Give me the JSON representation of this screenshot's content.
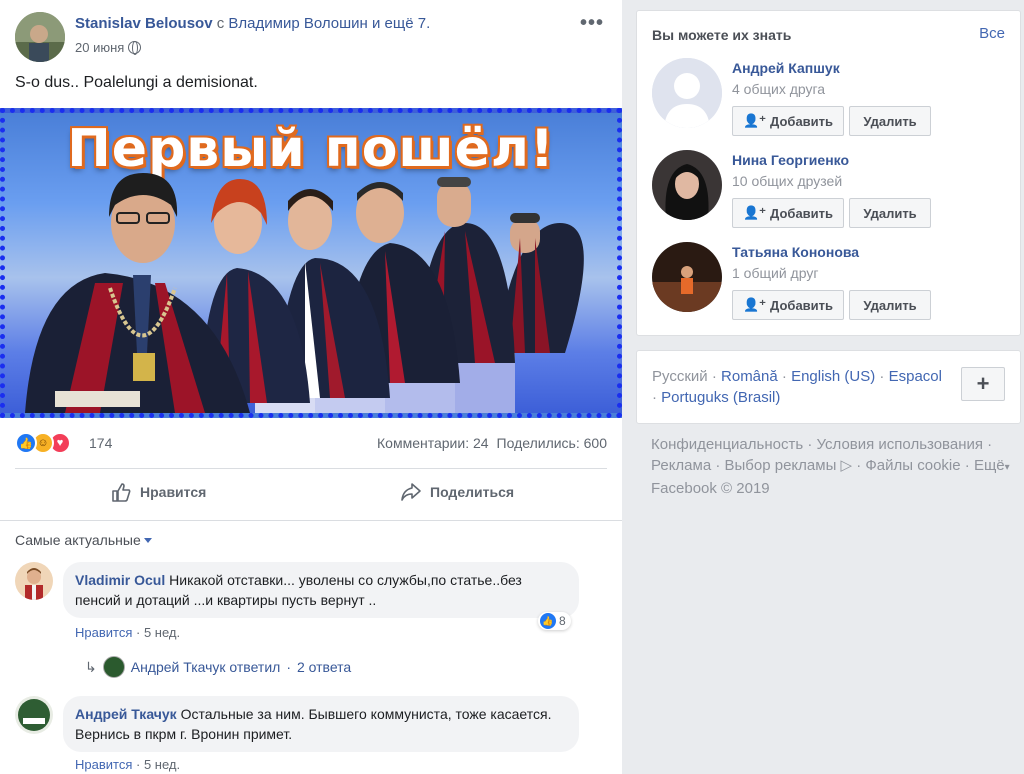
{
  "post": {
    "author": "Stanislav Belousov",
    "with_word": "с",
    "tagged": "Владимир Волошин",
    "and_others": "и ещё 7.",
    "date": "20 июня",
    "text": "S-o dus.. Poalelungi a demisionat.",
    "image_caption": "Первый пошёл!",
    "reaction_count": "174",
    "comments_stat": "Комментарии: 24",
    "shares_stat": "Поделились: 600",
    "like_label": "Нравится",
    "share_label": "Поделиться",
    "sort_label": "Самые актуальные"
  },
  "comments": [
    {
      "author": "Vladimir Ocul",
      "text": "Никакой отставки... уволены со службы,по статье..без пенсий и дотаций ...и квартиры пусть вернут ..",
      "like_action": "Нравится",
      "age": "5 нед.",
      "likes": "8",
      "reply_summary_author": "Андрей Ткачук ответил",
      "reply_count": "2 ответа"
    },
    {
      "author": "Андрей Ткачук",
      "text": "Остальные за ним. Бывшего коммуниста, тоже касается. Вернись в пкрм г. Вронин примет.",
      "like_action": "Нравится",
      "age": "5 нед."
    }
  ],
  "pymk": {
    "title": "Вы можете их знать",
    "see_all": "Все",
    "add_label": "Добавить",
    "remove_label": "Удалить",
    "people": [
      {
        "name": "Андрей Капшук",
        "mutual": "4 общих друга"
      },
      {
        "name": "Нина Георгиенко",
        "mutual": "10 общих друзей"
      },
      {
        "name": "Татьяна Кононова",
        "mutual": "1 общий друг"
      }
    ]
  },
  "languages": {
    "current": "Русский",
    "items": [
      "Română",
      "English (US)",
      "Espacol",
      "Portuguks (Brasil)"
    ],
    "plus": "+"
  },
  "footer": {
    "privacy": "Конфиденциальность",
    "terms": "Условия использования",
    "ads": "Реклама",
    "ad_choices": "Выбор рекламы",
    "cookies": "Файлы cookie",
    "more": "Ещё",
    "copyright": "Facebook © 2019"
  },
  "colors": {
    "link": "#385898",
    "accent": "#4267b2",
    "like_blue": "#2078f4",
    "love_red": "#f33e58",
    "haha_yellow": "#f7b125",
    "image_border": "#1a2ef0"
  }
}
